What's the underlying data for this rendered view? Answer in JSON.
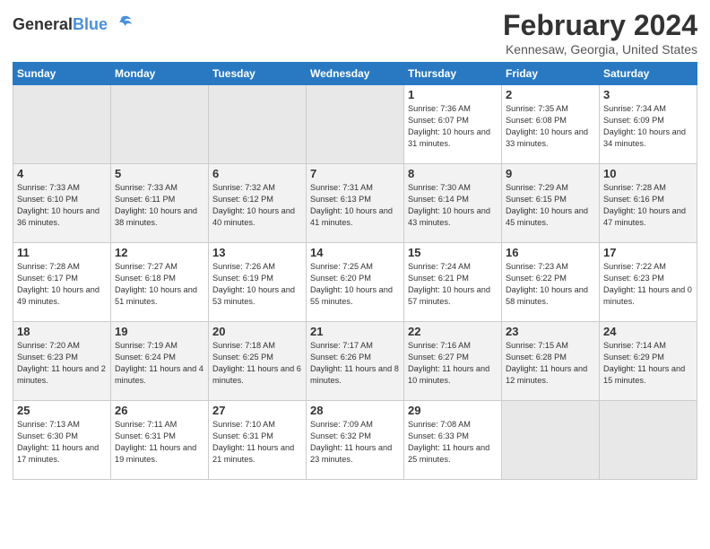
{
  "header": {
    "logo_line1": "General",
    "logo_line2": "Blue",
    "month": "February 2024",
    "location": "Kennesaw, Georgia, United States"
  },
  "days_of_week": [
    "Sunday",
    "Monday",
    "Tuesday",
    "Wednesday",
    "Thursday",
    "Friday",
    "Saturday"
  ],
  "weeks": [
    [
      {
        "day": "",
        "info": ""
      },
      {
        "day": "",
        "info": ""
      },
      {
        "day": "",
        "info": ""
      },
      {
        "day": "",
        "info": ""
      },
      {
        "day": "1",
        "info": "Sunrise: 7:36 AM\nSunset: 6:07 PM\nDaylight: 10 hours and 31 minutes."
      },
      {
        "day": "2",
        "info": "Sunrise: 7:35 AM\nSunset: 6:08 PM\nDaylight: 10 hours and 33 minutes."
      },
      {
        "day": "3",
        "info": "Sunrise: 7:34 AM\nSunset: 6:09 PM\nDaylight: 10 hours and 34 minutes."
      }
    ],
    [
      {
        "day": "4",
        "info": "Sunrise: 7:33 AM\nSunset: 6:10 PM\nDaylight: 10 hours and 36 minutes."
      },
      {
        "day": "5",
        "info": "Sunrise: 7:33 AM\nSunset: 6:11 PM\nDaylight: 10 hours and 38 minutes."
      },
      {
        "day": "6",
        "info": "Sunrise: 7:32 AM\nSunset: 6:12 PM\nDaylight: 10 hours and 40 minutes."
      },
      {
        "day": "7",
        "info": "Sunrise: 7:31 AM\nSunset: 6:13 PM\nDaylight: 10 hours and 41 minutes."
      },
      {
        "day": "8",
        "info": "Sunrise: 7:30 AM\nSunset: 6:14 PM\nDaylight: 10 hours and 43 minutes."
      },
      {
        "day": "9",
        "info": "Sunrise: 7:29 AM\nSunset: 6:15 PM\nDaylight: 10 hours and 45 minutes."
      },
      {
        "day": "10",
        "info": "Sunrise: 7:28 AM\nSunset: 6:16 PM\nDaylight: 10 hours and 47 minutes."
      }
    ],
    [
      {
        "day": "11",
        "info": "Sunrise: 7:28 AM\nSunset: 6:17 PM\nDaylight: 10 hours and 49 minutes."
      },
      {
        "day": "12",
        "info": "Sunrise: 7:27 AM\nSunset: 6:18 PM\nDaylight: 10 hours and 51 minutes."
      },
      {
        "day": "13",
        "info": "Sunrise: 7:26 AM\nSunset: 6:19 PM\nDaylight: 10 hours and 53 minutes."
      },
      {
        "day": "14",
        "info": "Sunrise: 7:25 AM\nSunset: 6:20 PM\nDaylight: 10 hours and 55 minutes."
      },
      {
        "day": "15",
        "info": "Sunrise: 7:24 AM\nSunset: 6:21 PM\nDaylight: 10 hours and 57 minutes."
      },
      {
        "day": "16",
        "info": "Sunrise: 7:23 AM\nSunset: 6:22 PM\nDaylight: 10 hours and 58 minutes."
      },
      {
        "day": "17",
        "info": "Sunrise: 7:22 AM\nSunset: 6:23 PM\nDaylight: 11 hours and 0 minutes."
      }
    ],
    [
      {
        "day": "18",
        "info": "Sunrise: 7:20 AM\nSunset: 6:23 PM\nDaylight: 11 hours and 2 minutes."
      },
      {
        "day": "19",
        "info": "Sunrise: 7:19 AM\nSunset: 6:24 PM\nDaylight: 11 hours and 4 minutes."
      },
      {
        "day": "20",
        "info": "Sunrise: 7:18 AM\nSunset: 6:25 PM\nDaylight: 11 hours and 6 minutes."
      },
      {
        "day": "21",
        "info": "Sunrise: 7:17 AM\nSunset: 6:26 PM\nDaylight: 11 hours and 8 minutes."
      },
      {
        "day": "22",
        "info": "Sunrise: 7:16 AM\nSunset: 6:27 PM\nDaylight: 11 hours and 10 minutes."
      },
      {
        "day": "23",
        "info": "Sunrise: 7:15 AM\nSunset: 6:28 PM\nDaylight: 11 hours and 12 minutes."
      },
      {
        "day": "24",
        "info": "Sunrise: 7:14 AM\nSunset: 6:29 PM\nDaylight: 11 hours and 15 minutes."
      }
    ],
    [
      {
        "day": "25",
        "info": "Sunrise: 7:13 AM\nSunset: 6:30 PM\nDaylight: 11 hours and 17 minutes."
      },
      {
        "day": "26",
        "info": "Sunrise: 7:11 AM\nSunset: 6:31 PM\nDaylight: 11 hours and 19 minutes."
      },
      {
        "day": "27",
        "info": "Sunrise: 7:10 AM\nSunset: 6:31 PM\nDaylight: 11 hours and 21 minutes."
      },
      {
        "day": "28",
        "info": "Sunrise: 7:09 AM\nSunset: 6:32 PM\nDaylight: 11 hours and 23 minutes."
      },
      {
        "day": "29",
        "info": "Sunrise: 7:08 AM\nSunset: 6:33 PM\nDaylight: 11 hours and 25 minutes."
      },
      {
        "day": "",
        "info": ""
      },
      {
        "day": "",
        "info": ""
      }
    ]
  ]
}
